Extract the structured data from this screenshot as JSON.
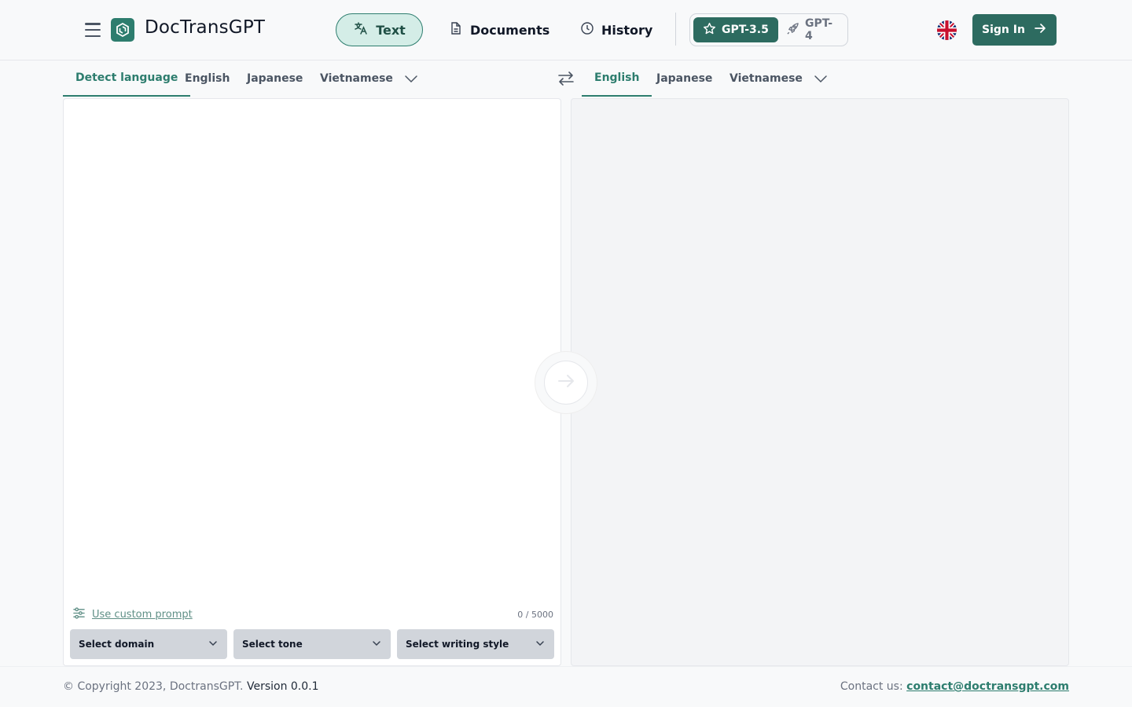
{
  "header": {
    "brand": "DocTransGPT",
    "nav": [
      {
        "label": "Text",
        "icon": "translate-icon",
        "active": true
      },
      {
        "label": "Documents",
        "icon": "document-icon",
        "active": false
      },
      {
        "label": "History",
        "icon": "clock-icon",
        "active": false
      }
    ],
    "models": [
      {
        "label": "GPT-3.5",
        "icon": "star-icon",
        "active": true
      },
      {
        "label": "GPT-4",
        "icon": "rocket-icon",
        "active": false
      }
    ],
    "language_flag": "uk-flag-icon",
    "signin_label": "Sign In"
  },
  "source_tabs": [
    {
      "label": "Detect language",
      "active": true
    },
    {
      "label": "English",
      "active": false
    },
    {
      "label": "Japanese",
      "active": false
    },
    {
      "label": "Vietnamese",
      "active": false
    }
  ],
  "target_tabs": [
    {
      "label": "English",
      "active": true
    },
    {
      "label": "Japanese",
      "active": false
    },
    {
      "label": "Vietnamese",
      "active": false
    }
  ],
  "source": {
    "value": "",
    "custom_prompt_label": "Use custom prompt",
    "char_count": "0 / 5000"
  },
  "selects": {
    "domain": "Select domain",
    "tone": "Select tone",
    "style": "Select writing style"
  },
  "footer": {
    "copyright": "© Copyright 2023, DoctransGPT.",
    "version": "Version 0.0.1",
    "contact_label": "Contact us:",
    "contact_email": "contact@doctransgpt.com"
  },
  "colors": {
    "accent": "#2d7d6e",
    "accent_dark": "#2d6b60",
    "active_bg": "#d4ede7"
  }
}
